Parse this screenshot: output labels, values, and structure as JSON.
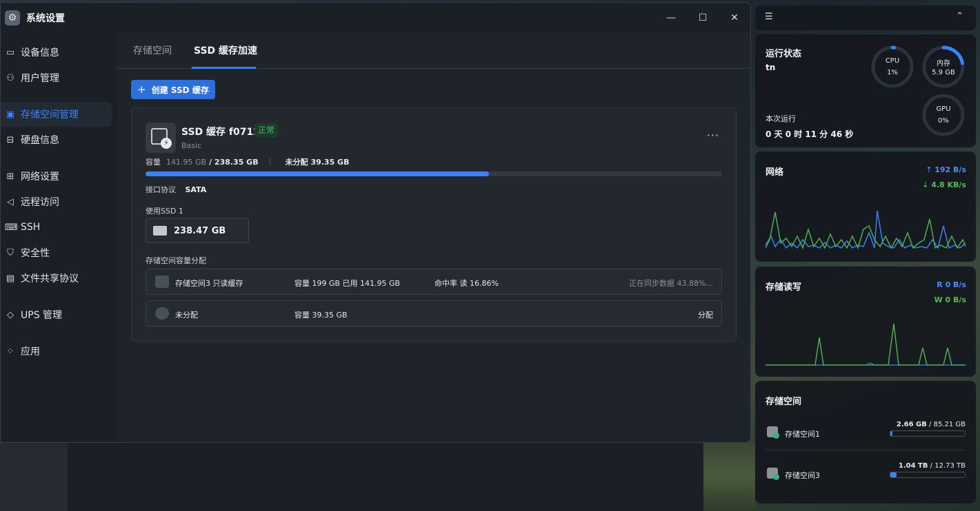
{
  "window": {
    "title": "系统设置",
    "controls": [
      "minimize",
      "maximize",
      "close"
    ]
  },
  "sidebar": {
    "items": [
      {
        "label": "设备信息",
        "icon": "device-icon"
      },
      {
        "label": "用户管理",
        "icon": "user-icon"
      },
      {
        "label": "存储空间管理",
        "icon": "storage-icon",
        "active": true
      },
      {
        "label": "硬盘信息",
        "icon": "disk-icon"
      },
      {
        "label": "网络设置",
        "icon": "network-icon"
      },
      {
        "label": "远程访问",
        "icon": "remote-icon"
      },
      {
        "label": "SSH",
        "icon": "ssh-icon"
      },
      {
        "label": "安全性",
        "icon": "shield-icon"
      },
      {
        "label": "文件共享协议",
        "icon": "file-share-icon"
      },
      {
        "label": "UPS 管理",
        "icon": "ups-icon"
      },
      {
        "label": "应用",
        "icon": "apps-icon"
      }
    ]
  },
  "tabs": [
    {
      "label": "存储空间",
      "active": false
    },
    {
      "label": "SSD 缓存加速",
      "active": true
    }
  ],
  "create_button": {
    "label": "创建 SSD 缓存"
  },
  "cache": {
    "name": "SSD 缓存 f0712",
    "status": "正常",
    "type": "Basic",
    "capacity_label": "容量",
    "used": "141.95 GB",
    "total": "/ 238.35 GB",
    "unallocated": "未分配 39.35 GB",
    "usage_fraction": 0.596,
    "protocol_label": "接口协议",
    "protocol": "SATA",
    "use_label": "使用SSD 1",
    "disk_size": "238.47 GB",
    "alloc_label": "存储空间容量分配",
    "alloc_rows": [
      {
        "name": "存储空间3  只读缓存",
        "capacity": "容量 199 GB  已用 141.95 GB",
        "hit": "命中率  读 16.86%",
        "status": "正在同步数据 43.88%..."
      },
      {
        "name": "未分配",
        "capacity": "容量 39.35 GB",
        "hit": "",
        "status": "分配"
      }
    ]
  },
  "widgets": {
    "runtime": {
      "title": "运行状态",
      "host": "tn",
      "cpu_label": "CPU",
      "cpu_value": "1%",
      "cpu_fraction": 0.01,
      "mem_label": "内存",
      "mem_value": "5.9 GB",
      "mem_fraction": 0.22,
      "gpu_label": "GPU",
      "gpu_value": "0%",
      "gpu_fraction": 0,
      "uptime_label": "本次运行",
      "uptime": "0 天 0 时 11 分 46 秒"
    },
    "network": {
      "title": "网络",
      "up": "192 B/s",
      "down": "4.8 KB/s"
    },
    "disk_io": {
      "title": "存储读写",
      "read": "R  0 B/s",
      "write": "W  0 B/s"
    },
    "storage": {
      "title": "存储空间",
      "items": [
        {
          "name": "存储空间1",
          "used": "2.66 GB",
          "total": "/ 85.21 GB",
          "fraction": 0.03
        },
        {
          "name": "存储空间3",
          "used": "1.04 TB",
          "total": "/ 12.73 TB",
          "fraction": 0.08
        }
      ]
    }
  },
  "colors": {
    "accent": "#3b82f6",
    "ok": "#3fbf6a",
    "down": "#4caf50"
  }
}
